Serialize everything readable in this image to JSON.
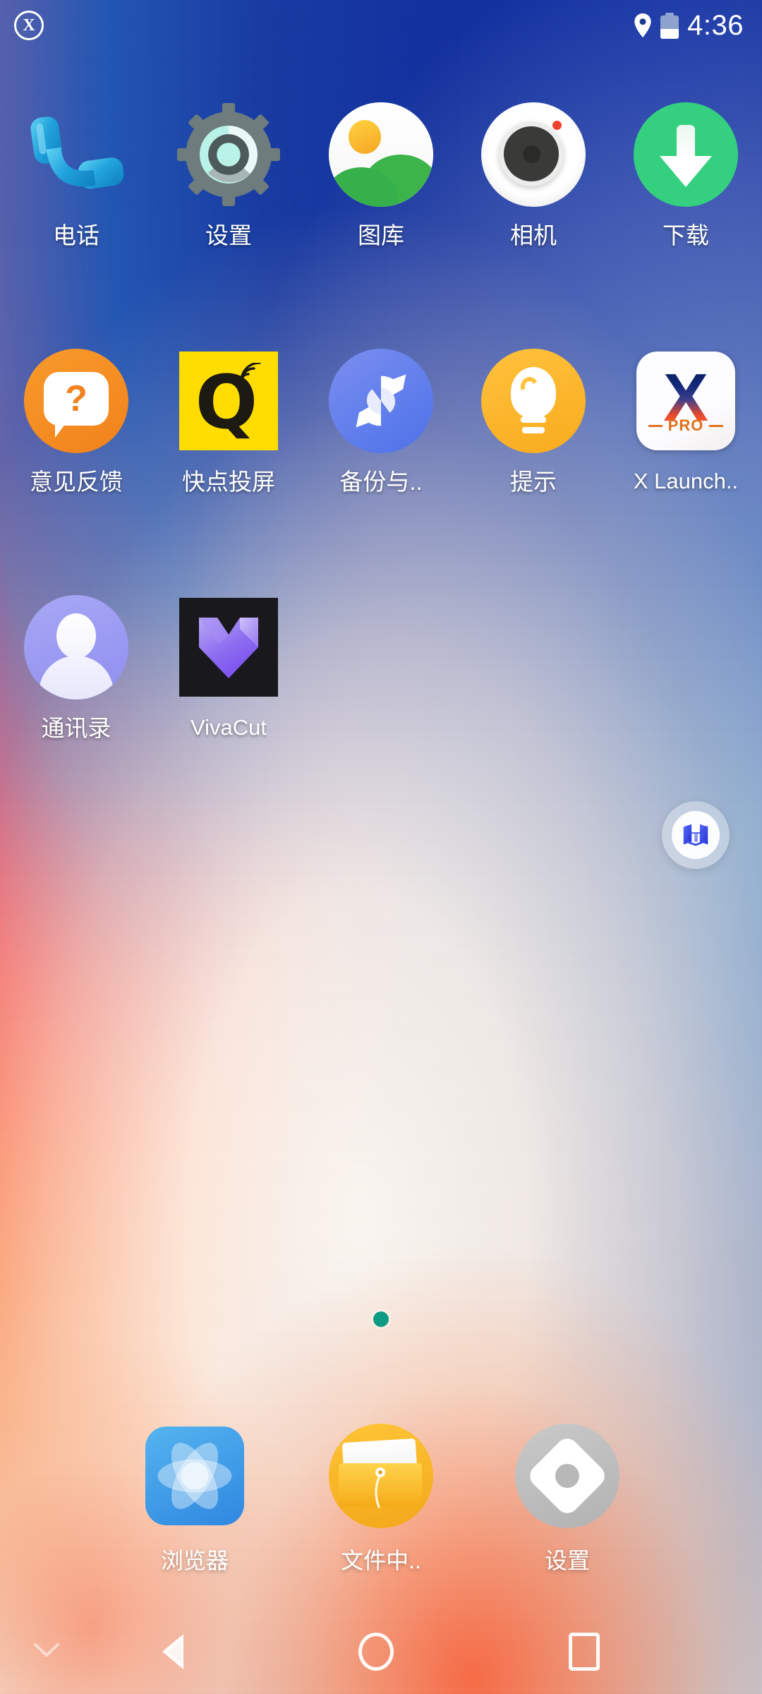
{
  "status_bar": {
    "launcher_badge": "X",
    "icons": [
      "location-pin-icon",
      "battery-icon"
    ],
    "battery_level_percent": 42,
    "time": "4:36"
  },
  "home_screen": {
    "apps": [
      {
        "label": "电话",
        "icon": "phone-icon",
        "row": 1,
        "col": 1
      },
      {
        "label": "设置",
        "icon": "settings-gear-icon",
        "row": 1,
        "col": 2
      },
      {
        "label": "图库",
        "icon": "gallery-icon",
        "row": 1,
        "col": 3
      },
      {
        "label": "相机",
        "icon": "camera-icon",
        "row": 1,
        "col": 4
      },
      {
        "label": "下载",
        "icon": "download-icon",
        "row": 1,
        "col": 5
      },
      {
        "label": "意见反馈",
        "icon": "feedback-icon",
        "row": 2,
        "col": 1
      },
      {
        "label": "快点投屏",
        "icon": "screencast-q-icon",
        "row": 2,
        "col": 2
      },
      {
        "label": "备份与..",
        "icon": "backup-sync-icon",
        "row": 2,
        "col": 3
      },
      {
        "label": "提示",
        "icon": "tips-bulb-icon",
        "row": 2,
        "col": 4
      },
      {
        "label": "X Launch..",
        "icon": "x-launcher-icon",
        "row": 2,
        "col": 5
      },
      {
        "label": "通讯录",
        "icon": "contacts-icon",
        "row": 3,
        "col": 1
      },
      {
        "label": "VivaCut",
        "icon": "vivacut-icon",
        "row": 3,
        "col": 2
      }
    ],
    "x_launcher_badge_text": "PRO",
    "feedback_glyph": "?",
    "screencast_glyph": "Q",
    "x_launcher_glyph": "X"
  },
  "assist_ball": {
    "icon": "cube-box-icon"
  },
  "page_indicator": {
    "total_pages": 1,
    "current_page": 1,
    "dot_color": "#0e9b83"
  },
  "dock": {
    "apps": [
      {
        "label": "浏览器",
        "icon": "browser-icon"
      },
      {
        "label": "文件中..",
        "icon": "file-manager-icon"
      },
      {
        "label": "设置",
        "icon": "settings-icon"
      }
    ]
  },
  "nav_bar": {
    "buttons": [
      {
        "name": "collapse-chevron",
        "icon": "chevron-down-icon"
      },
      {
        "name": "back",
        "icon": "back-triangle-icon"
      },
      {
        "name": "home",
        "icon": "home-circle-icon"
      },
      {
        "name": "recents",
        "icon": "recents-square-icon"
      }
    ]
  },
  "theme": {
    "wallpaper": "iphone-x-gradient",
    "accent_pink": "#f20f63",
    "accent_blue": "#12309f",
    "accent_orange": "#fd6134",
    "label_color": "#ffffff"
  }
}
